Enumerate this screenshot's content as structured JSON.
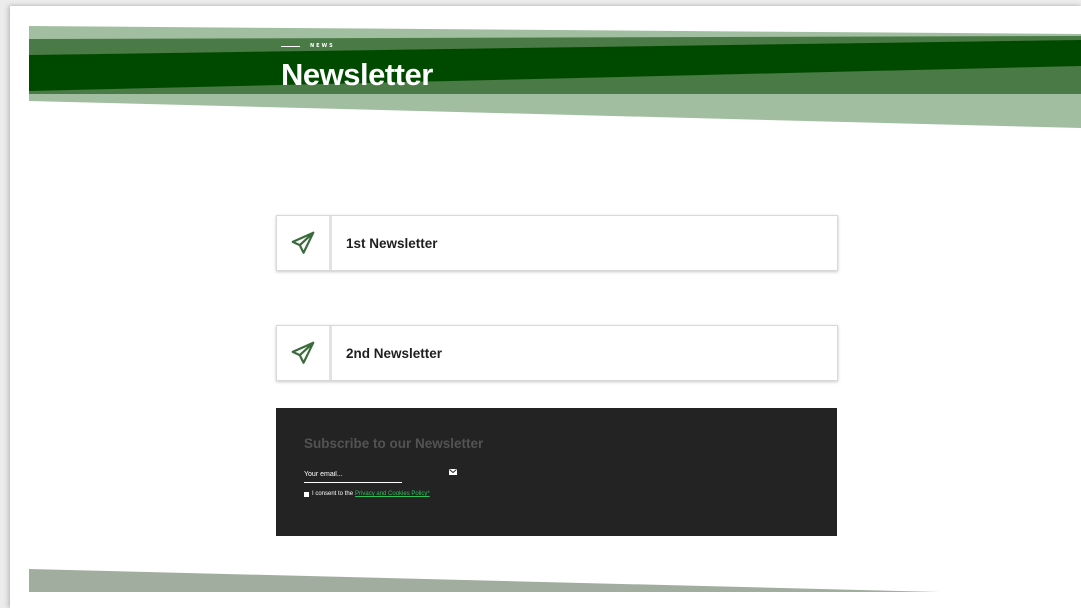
{
  "header": {
    "eyebrow": "NEWS",
    "title": "Newsletter"
  },
  "newsletters": [
    {
      "label": "1st Newsletter",
      "icon": "paper-plane-icon"
    },
    {
      "label": "2nd Newsletter",
      "icon": "paper-plane-icon"
    }
  ],
  "subscribe": {
    "title": "Subscribe to our Newsletter",
    "email_placeholder": "Your email...",
    "send_icon": "envelope-icon",
    "consent_prefix": "I consent to the",
    "consent_link": "Privacy and Cookies Policy*"
  },
  "colors": {
    "dark_green": "#004a00",
    "mid_green": "#4a7a45",
    "light_green": "#a1bfa0",
    "footer_band": "#a1ad9f",
    "subscribe_bg": "#232323",
    "link_green": "#2fbf5c"
  }
}
